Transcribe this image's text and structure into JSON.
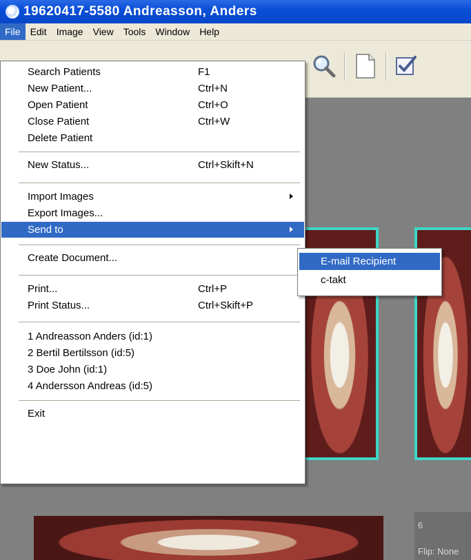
{
  "window": {
    "title": "19620417-5580 Andreasson, Anders"
  },
  "menubar": {
    "items": [
      "File",
      "Edit",
      "Image",
      "View",
      "Tools",
      "Window",
      "Help"
    ]
  },
  "toolbar": {
    "icons": [
      "magnifier-icon",
      "new-document-icon",
      "checklist-icon"
    ]
  },
  "file_menu": {
    "items": [
      {
        "label": "Search Patients",
        "shortcut": "F1"
      },
      {
        "label": "New Patient...",
        "shortcut": "Ctrl+N"
      },
      {
        "label": "Open Patient",
        "shortcut": "Ctrl+O"
      },
      {
        "label": "Close Patient",
        "shortcut": "Ctrl+W"
      },
      {
        "label": "Delete Patient",
        "shortcut": ""
      },
      {
        "label": "New Status...",
        "shortcut": "Ctrl+Skift+N"
      },
      {
        "label": "Import Images",
        "shortcut": ""
      },
      {
        "label": "Export Images...",
        "shortcut": ""
      },
      {
        "label": "Send to",
        "shortcut": ""
      },
      {
        "label": "Create Document...",
        "shortcut": ""
      },
      {
        "label": "Print...",
        "shortcut": "Ctrl+P"
      },
      {
        "label": "Print Status...",
        "shortcut": "Ctrl+Skift+P"
      },
      {
        "label": "1 Andreasson Anders (id:1)",
        "shortcut": ""
      },
      {
        "label": "2 Bertil Bertilsson (id:5)",
        "shortcut": ""
      },
      {
        "label": "3 Doe John (id:1)",
        "shortcut": ""
      },
      {
        "label": "4 Andersson Andreas (id:5)",
        "shortcut": ""
      },
      {
        "label": "Exit",
        "shortcut": ""
      }
    ]
  },
  "send_to_submenu": {
    "items": [
      "E-mail Recipient",
      "c-takt"
    ]
  },
  "image_info": {
    "number": "6",
    "flip": "Flip: None"
  },
  "colors": {
    "highlight": "#316ac5",
    "thumbnail_border": "#3fd6c8",
    "titlebar": "#0a4fd8"
  }
}
